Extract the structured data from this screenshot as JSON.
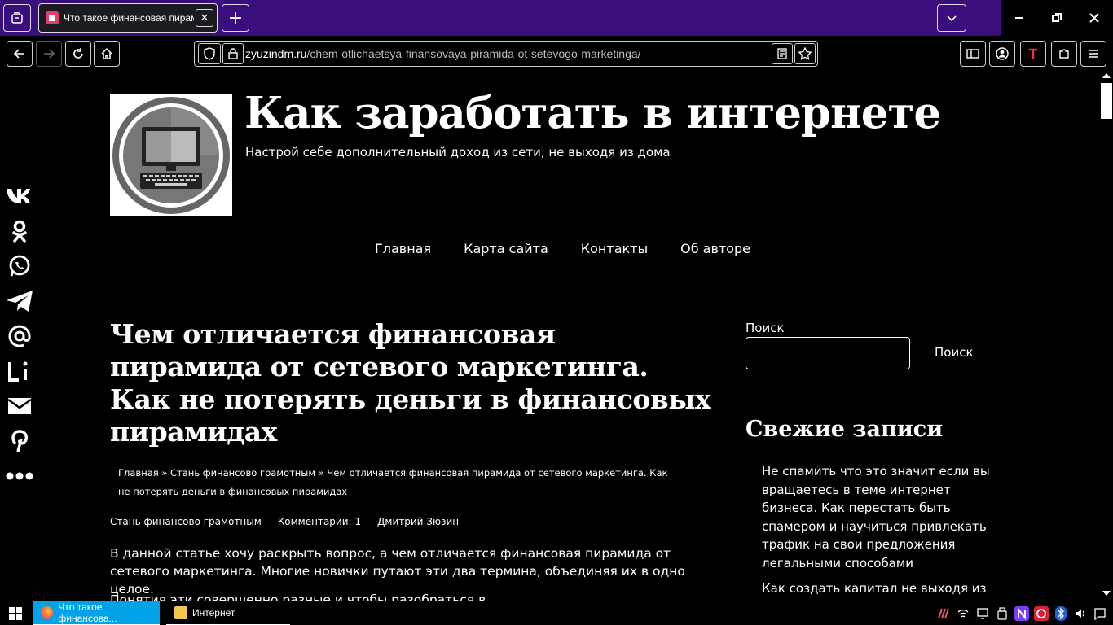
{
  "browser": {
    "tab_title": "Что такое финансовая пирамида",
    "tab_close": "✕",
    "new_tab": "+",
    "url_host": "zyuzindm.ru",
    "url_path": "/chem-otlichaetsya-finansovaya-piramida-ot-setevogo-marketinga/"
  },
  "site": {
    "title": "Как заработать в интернете",
    "description": "Настрой себе дополнительный доход из сети, не выходя из дома"
  },
  "nav": {
    "items": [
      "Главная",
      "Карта сайта",
      "Контакты",
      "Об авторе"
    ]
  },
  "share": {
    "items": [
      {
        "icon": "vk-icon",
        "glyph": "VK"
      },
      {
        "icon": "odnoklassniki-icon",
        "glyph": "ok"
      },
      {
        "icon": "whatsapp-icon",
        "glyph": "wa"
      },
      {
        "icon": "telegram-icon",
        "glyph": "tg"
      },
      {
        "icon": "email-at-icon",
        "glyph": "@"
      },
      {
        "icon": "livejournal-icon",
        "glyph": "Li"
      },
      {
        "icon": "mail-icon",
        "glyph": "✉"
      },
      {
        "icon": "pinterest-icon",
        "glyph": "P"
      },
      {
        "icon": "more-icon",
        "glyph": "•••"
      }
    ]
  },
  "post": {
    "title": "Чем отличается финансовая пирамида от сетевого маркетинга. Как не потерять деньги в финансовых пирамидах",
    "breadcrumb": "Главная » Стань финансово грамотным » Чем отличается финансовая пирамида от сетевого маркетинга. Как не потерять деньги в финансовых пирамидах",
    "category": "Стань финансово грамотным",
    "comments": "Комментарии: 1",
    "author": "Дмитрий Зюзин",
    "intro": "В данной статье хочу раскрыть вопрос, а чем отличается финансовая пирамида от сетевого маркетинга. Многие новички путают эти два термина, объединяя их в одно целое.",
    "next_line": "Понятия эти совершенно разные и чтобы разобраться в этом"
  },
  "sidebar": {
    "search_label": "Поиск",
    "search_placeholder": "",
    "search_button": "Поиск",
    "recent_title": "Свежие записи",
    "recent": [
      "Не спамить что это значит если вы вращаетесь в теме интернет бизнеса. Как перестать быть спамером и научиться привлекать трафик на свои предложения легальными способами",
      "Как создать капитал не выходя из"
    ]
  },
  "taskbar": {
    "items": [
      "Что такое финансова...",
      "Интернет"
    ]
  },
  "colors": {
    "tabstrip": "#3b0e7e",
    "taskbar_active": "#00a2e8",
    "page_bg": "#000000",
    "text": "#ffffff"
  }
}
